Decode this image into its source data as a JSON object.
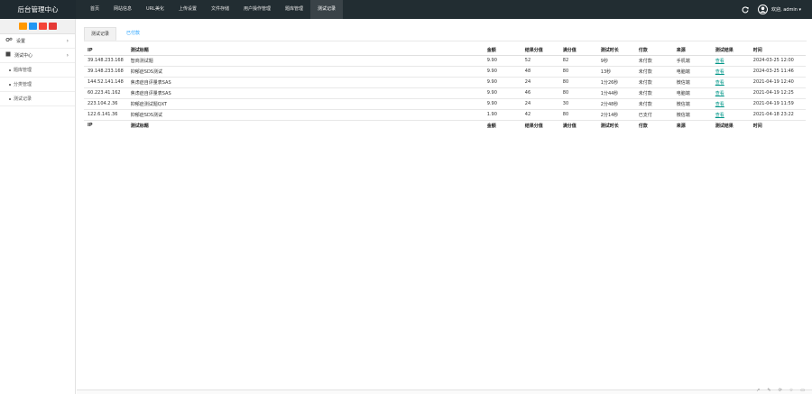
{
  "brand": "后台管理中心",
  "nav": [
    {
      "label": "首页",
      "active": false
    },
    {
      "label": "网站信息",
      "active": false
    },
    {
      "label": "URL美化",
      "active": false
    },
    {
      "label": "上传设置",
      "active": false
    },
    {
      "label": "文件存储",
      "active": false
    },
    {
      "label": "用户操作管理",
      "active": false
    },
    {
      "label": "题库管理",
      "active": false
    },
    {
      "label": "测试记录",
      "active": true
    }
  ],
  "user": {
    "name": "欢迎, admin ▾"
  },
  "colors": {
    "topbar": "#222d32",
    "accent": "#009688",
    "link_blue": "#1e9fff",
    "qbtn1": "#ff9800",
    "qbtn2": "#2196f3",
    "qbtn3": "#f44336",
    "qbtn4": "#e53935"
  },
  "sidebar": {
    "items": [
      {
        "label": "设置",
        "icon": "gears-icon",
        "chevron": "›"
      },
      {
        "label": "测试中心",
        "icon": "book-icon",
        "chevron": "›"
      }
    ],
    "subitems": [
      {
        "label": "题库管理"
      },
      {
        "label": "分类管理"
      },
      {
        "label": "测试记录"
      }
    ]
  },
  "tabs": [
    {
      "label": "测试记录",
      "active": true
    },
    {
      "label": "已付款",
      "active": false
    }
  ],
  "table": {
    "headers": [
      "IP",
      "测试标题",
      "金额",
      "结果分值",
      "满分值",
      "测试时长",
      "付款",
      "来源",
      "测试结果",
      "时间"
    ],
    "rows": [
      [
        "39.148.233.168",
        "智商测试题",
        "9.90",
        "52",
        "82",
        "9秒",
        "未付款",
        "手机端",
        "查看",
        "2024-03-25 12:00"
      ],
      [
        "39.148.233.168",
        "抑郁症SDS测试",
        "9.90",
        "48",
        "80",
        "13秒",
        "未付款",
        "电脑端",
        "查看",
        "2024-03-25 11:46"
      ],
      [
        "144.52.141.148",
        "焦虑症自评量表SAS",
        "9.90",
        "24",
        "80",
        "1分26秒",
        "未付款",
        "微信端",
        "查看",
        "2021-04-19 12:40"
      ],
      [
        "60.223.41.162",
        "焦虑症自评量表SAS",
        "9.90",
        "46",
        "80",
        "1分44秒",
        "未付款",
        "电脑端",
        "查看",
        "2021-04-19 12:25"
      ],
      [
        "223.104.2.36",
        "抑郁症测试题QXT",
        "9.90",
        "24",
        "30",
        "2分48秒",
        "未付款",
        "微信端",
        "查看",
        "2021-04-19 11:59"
      ],
      [
        "122.6.141.36",
        "抑郁症SDS测试",
        "1.90",
        "42",
        "80",
        "2分14秒",
        "已支付",
        "微信端",
        "查看",
        "2021-04-18 23:22"
      ]
    ]
  },
  "statusbar_icons": [
    "share-icon",
    "comment-icon",
    "refresh-icon",
    "star-icon",
    "folder-icon"
  ]
}
